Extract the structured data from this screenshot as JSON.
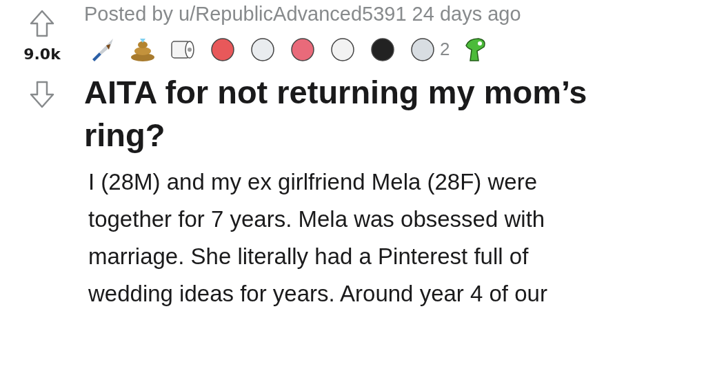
{
  "vote": {
    "score": "9.0k"
  },
  "post": {
    "byline": "Posted by u/RepublicAdvanced5391 24 days ago",
    "awards": [
      {
        "kind": "knife"
      },
      {
        "kind": "pile"
      },
      {
        "kind": "paper"
      },
      {
        "kind": "head",
        "color": "#e8585a"
      },
      {
        "kind": "head",
        "color": "#e9ecef"
      },
      {
        "kind": "head",
        "color": "#e96a7a"
      },
      {
        "kind": "head",
        "color": "#f2f2f2"
      },
      {
        "kind": "head",
        "color": "#222222"
      },
      {
        "kind": "head",
        "color": "#d8dde2",
        "count": "2"
      },
      {
        "kind": "dino"
      }
    ],
    "title": "AITA for not returning my mom’s ring?",
    "body_lines": [
      "I (28M) and my ex girlfriend Mela (28F) were",
      "together for 7 years. Mela was obsessed with",
      "marriage. She literally had a Pinterest full of",
      "wedding ideas for years. Around year 4 of our"
    ]
  }
}
